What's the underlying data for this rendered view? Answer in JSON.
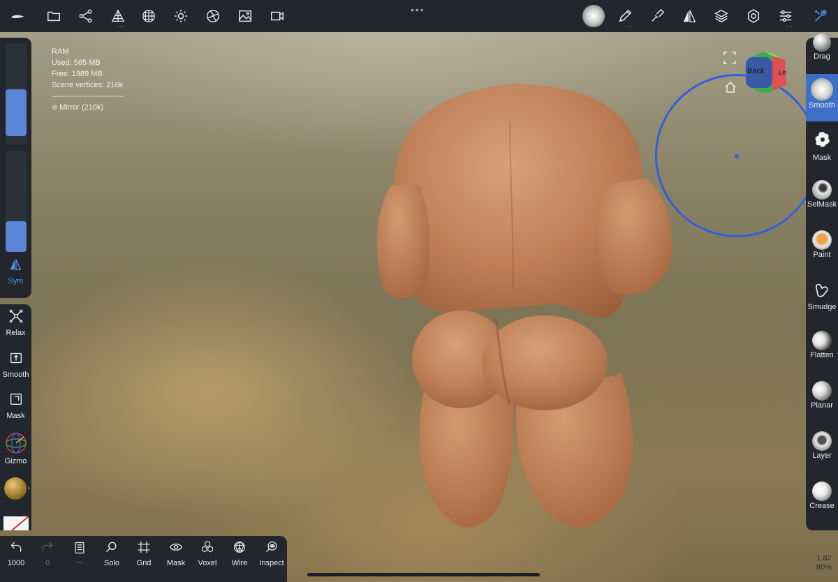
{
  "stats": {
    "ram_label": "RAM",
    "used": "Used: 565 MB",
    "free": "Free: 1989 MB",
    "vertices": "Scene vertices: 216k",
    "divider": "----------------------------",
    "mirror": "Mirror (210k)"
  },
  "left_panel": {
    "sliders": {
      "radius_level": 0.46,
      "intensity_level": 0.3
    },
    "sym_label": "Sym",
    "tools": [
      {
        "label": "Relax",
        "icon": "relax-icon"
      },
      {
        "label": "Smooth",
        "icon": "smooth-box-icon"
      },
      {
        "label": "Mask",
        "icon": "mask-box-icon"
      },
      {
        "label": "Gizmo",
        "icon": "gizmo-icon"
      }
    ]
  },
  "bottom_bar": {
    "undo_count": "1000",
    "redo_count": "0",
    "items": [
      {
        "label": "Solo",
        "icon": "search-icon"
      },
      {
        "label": "Grid",
        "icon": "grid-icon"
      },
      {
        "label": "Mask",
        "icon": "eye-icon"
      },
      {
        "label": "Voxel",
        "icon": "voxel-icon"
      },
      {
        "label": "Wire",
        "icon": "wire-icon"
      },
      {
        "label": "Inspect",
        "icon": "inspect-icon"
      }
    ],
    "more_dots": "..."
  },
  "right_panel": {
    "tools": [
      {
        "label": "Drag",
        "active": false
      },
      {
        "label": "Smooth",
        "active": true
      },
      {
        "label": "Mask",
        "active": false
      },
      {
        "label": "SelMask",
        "active": false
      },
      {
        "label": "Paint",
        "active": false
      },
      {
        "label": "Smudge",
        "active": false
      },
      {
        "label": "Flatten",
        "active": false
      },
      {
        "label": "Planar",
        "active": false
      },
      {
        "label": "Layer",
        "active": false
      },
      {
        "label": "Crease",
        "active": false
      }
    ]
  },
  "nav_cube": {
    "front_face": "Back",
    "side_face": "Lef"
  },
  "zoom": {
    "line1": "1.82",
    "line2": "80%"
  },
  "colors": {
    "panel": "#23262d",
    "accent": "#3f6fc6",
    "ring": "#2f5fe0"
  }
}
